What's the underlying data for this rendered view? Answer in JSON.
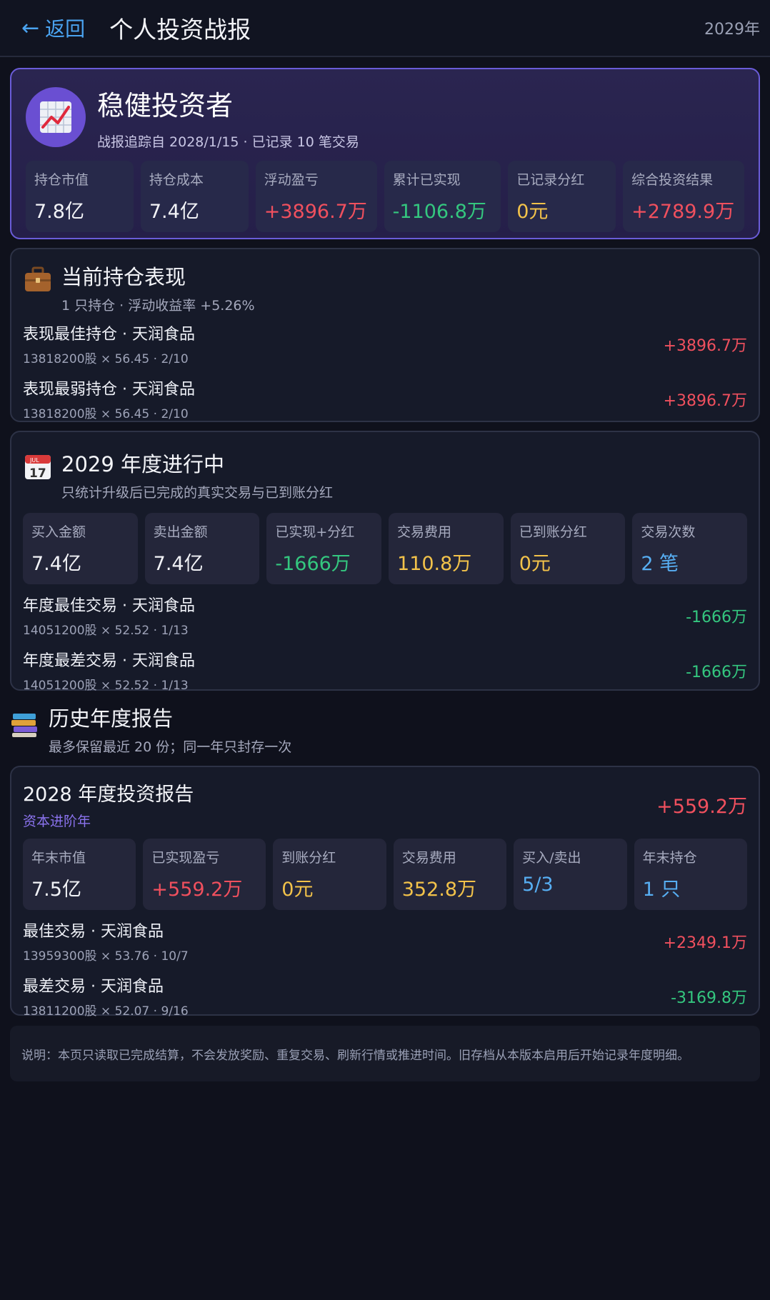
{
  "header": {
    "back_label": "返回",
    "title": "个人投资战报",
    "year": "2029年"
  },
  "hero": {
    "name": "稳健投资者",
    "subtitle": "战报追踪自 2028/1/15 · 已记录 10 笔交易",
    "stats": [
      {
        "label": "持仓市值",
        "value": "7.8亿"
      },
      {
        "label": "持仓成本",
        "value": "7.4亿"
      },
      {
        "label": "浮动盈亏",
        "value": "+3896.7万"
      },
      {
        "label": "累计已实现",
        "value": "-1106.8万"
      },
      {
        "label": "已记录分红",
        "value": "0元"
      },
      {
        "label": "综合投资结果",
        "value": "+2789.9万"
      }
    ]
  },
  "positions": {
    "title": "当前持仓表现",
    "subtitle": "1 只持仓 · 浮动收益率 +5.26%",
    "rows": [
      {
        "title": "表现最佳持仓 · 天润食品",
        "meta": "13818200股 × 56.45 · 2/10",
        "value": "+3896.7万"
      },
      {
        "title": "表现最弱持仓 · 天润食品",
        "meta": "13818200股 × 56.45 · 2/10",
        "value": "+3896.7万"
      }
    ]
  },
  "current_year": {
    "title": "2029 年度进行中",
    "subtitle": "只统计升级后已完成的真实交易与已到账分红",
    "stats": [
      {
        "label": "买入金额",
        "value": "7.4亿"
      },
      {
        "label": "卖出金额",
        "value": "7.4亿"
      },
      {
        "label": "已实现+分红",
        "value": "-1666万"
      },
      {
        "label": "交易费用",
        "value": "110.8万"
      },
      {
        "label": "已到账分红",
        "value": "0元"
      },
      {
        "label": "交易次数",
        "value": "2 笔"
      }
    ],
    "rows": [
      {
        "title": "年度最佳交易 · 天润食品",
        "meta": "14051200股 × 52.52 · 1/13",
        "value": "-1666万"
      },
      {
        "title": "年度最差交易 · 天润食品",
        "meta": "14051200股 × 52.52 · 1/13",
        "value": "-1666万"
      }
    ]
  },
  "history": {
    "title": "历史年度报告",
    "subtitle": "最多保留最近 20 份；同一年只封存一次"
  },
  "report_2028": {
    "title": "2028 年度投资报告",
    "tag": "资本进阶年",
    "total": "+559.2万",
    "stats": [
      {
        "label": "年末市值",
        "value": "7.5亿"
      },
      {
        "label": "已实现盈亏",
        "value": "+559.2万"
      },
      {
        "label": "到账分红",
        "value": "0元"
      },
      {
        "label": "交易费用",
        "value": "352.8万"
      },
      {
        "label": "买入/卖出",
        "value": "5/3"
      },
      {
        "label": "年末持仓",
        "value": "1 只"
      }
    ],
    "rows": [
      {
        "title": "最佳交易 · 天润食品",
        "meta": "13959300股 × 53.76 · 10/7",
        "value": "+2349.1万"
      },
      {
        "title": "最差交易 · 天润食品",
        "meta": "13811200股 × 52.07 · 9/16",
        "value": "-3169.8万"
      }
    ]
  },
  "note": "说明：本页只读取已完成结算，不会发放奖励、重复交易、刷新行情或推进时间。旧存档从本版本启用后开始记录年度明细。",
  "icons": {
    "back": "left-arrow-icon",
    "avatar": "chart-up-icon",
    "positions": "briefcase-icon",
    "current_year": "calendar-icon",
    "history": "books-icon"
  }
}
